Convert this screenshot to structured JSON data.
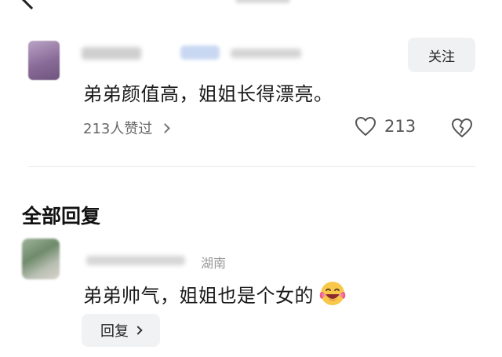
{
  "top_comment": {
    "follow_label": "关注",
    "text": "弟弟颜值高，姐姐长得漂亮。",
    "likers_label": "213人赞过",
    "like_count": "213"
  },
  "replies_section": {
    "title": "全部回复",
    "items": [
      {
        "location": "湖南",
        "text": "弟弟帅气，姐姐也是个女的",
        "emoji": "laughing-tears-emoji",
        "reply_label": "回复"
      }
    ]
  },
  "icons": {
    "back": "chevron-left-icon",
    "like": "heart-outline-icon",
    "dislike": "broken-heart-icon",
    "likers_more": "chevron-right-icon",
    "reply_more": "chevron-right-icon"
  }
}
